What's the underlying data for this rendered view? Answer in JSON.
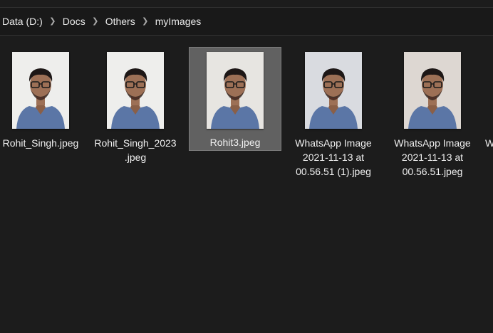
{
  "breadcrumb": {
    "items": [
      "Data (D:)",
      "Docs",
      "Others",
      "myImages"
    ]
  },
  "files": [
    {
      "name": "Rohit_Singh.jpeg",
      "selected": false,
      "background": "#eeeeec"
    },
    {
      "name": "Rohit_Singh_2023\n.jpeg",
      "selected": false,
      "background": "#eeeeec"
    },
    {
      "name": "Rohit3.jpeg",
      "selected": true,
      "background": "#e7e5e1"
    },
    {
      "name": "WhatsApp Image\n2021-11-13 at\n00.56.51 (1).jpeg",
      "selected": false,
      "background": "#d9dbe0"
    },
    {
      "name": "WhatsApp Image\n2021-11-13 at\n00.56.51.jpeg",
      "selected": false,
      "background": "#ddd7d2"
    },
    {
      "name": "W",
      "selected": false,
      "background": "#1c1c1c"
    }
  ],
  "colors": {
    "shirt": "#5b76a6",
    "skin": "#9d7056",
    "hair": "#1d1716",
    "glasses": "#1a1a1a",
    "selected_bg": "#616161"
  }
}
